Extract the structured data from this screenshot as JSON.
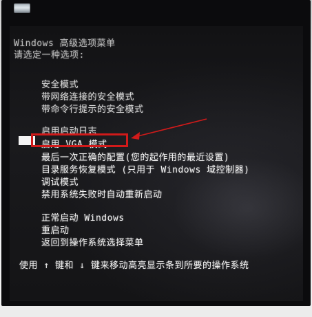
{
  "screen": {
    "title_line1": "Windows 高级选项菜单",
    "title_line2": "请选定一种选项:",
    "group1": [
      "安全模式",
      "带网络连接的安全模式",
      "带命令行提示的安全模式"
    ],
    "group2": [
      "启用启动日志",
      "启用 VGA 模式",
      "最后一次正确的配置(您的起作用的最近设置)",
      "目录服务恢复模式 (只用于 Windows 域控制器)",
      "调试模式",
      "禁用系统失败时自动重新启动"
    ],
    "group3": [
      "正常启动 Windows",
      "重启动",
      "返回到操作系统选择菜单"
    ],
    "footer": "使用 ↑ 键和 ↓ 键来移动高亮显示条到所要的操作系统"
  },
  "annotation": {
    "highlight_color": "#d11a1a"
  }
}
